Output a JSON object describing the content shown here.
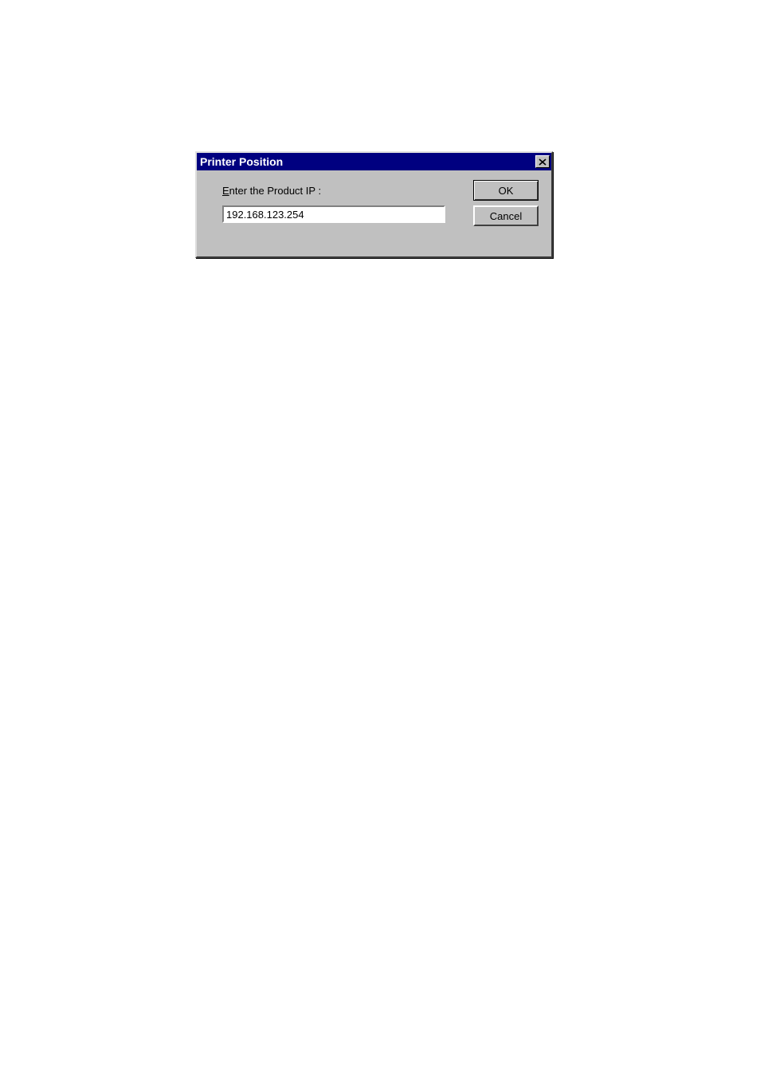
{
  "dialog": {
    "title": "Printer Position",
    "label_mnemonic": "E",
    "label_rest": "nter the Product IP :",
    "ip_value": "192.168.123.254",
    "ok_label": "OK",
    "cancel_label": "Cancel"
  }
}
